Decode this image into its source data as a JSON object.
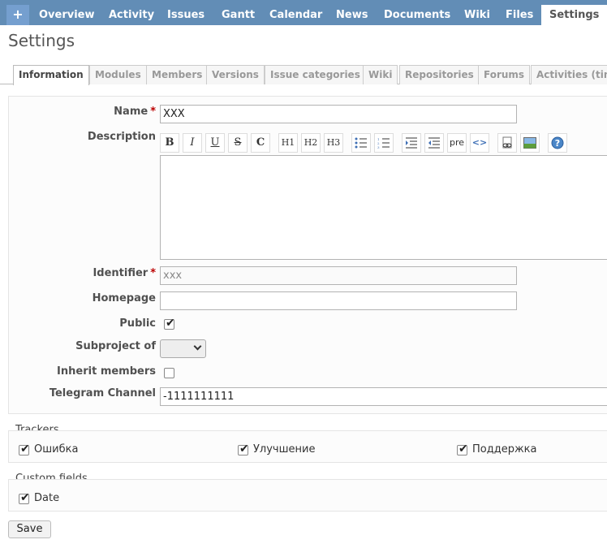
{
  "topmenu": {
    "plus_label": "+",
    "items": [
      "Overview",
      "Activity",
      "Issues",
      "Gantt",
      "Calendar",
      "News",
      "Documents",
      "Wiki",
      "Files",
      "Settings"
    ],
    "active": "Settings"
  },
  "page": {
    "title": "Settings"
  },
  "tabs": [
    "Information",
    "Modules",
    "Members",
    "Versions",
    "Issue categories",
    "Wiki",
    "Repositories",
    "Forums",
    "Activities (tim"
  ],
  "form": {
    "name_label": "Name",
    "name_value": "XXX",
    "description_label": "Description",
    "identifier_label": "Identifier",
    "identifier_value": "xxx",
    "homepage_label": "Homepage",
    "homepage_value": "",
    "public_label": "Public",
    "public_checked": true,
    "subproject_label": "Subproject of",
    "subproject_value": "",
    "inherit_label": "Inherit members",
    "inherit_checked": false,
    "telegram_label": "Telegram Channel",
    "telegram_value": "-1111111111",
    "required_mark": "*"
  },
  "toolbar": {
    "bold": "B",
    "italic": "I",
    "underline": "U",
    "strike": "S",
    "code": "C",
    "h1": "H1",
    "h2": "H2",
    "h3": "H3",
    "pre": "pre",
    "html": "<>"
  },
  "trackers": {
    "legend": "Trackers",
    "items": [
      {
        "label": "Ошибка",
        "checked": true
      },
      {
        "label": "Улучшение",
        "checked": true
      },
      {
        "label": "Поддержка",
        "checked": true
      }
    ]
  },
  "custom_fields": {
    "legend": "Custom fields",
    "items": [
      {
        "label": "Date",
        "checked": true
      }
    ]
  },
  "save_label": "Save",
  "colors": {
    "menu_bg": "#628db6",
    "required": "#bb0000"
  }
}
